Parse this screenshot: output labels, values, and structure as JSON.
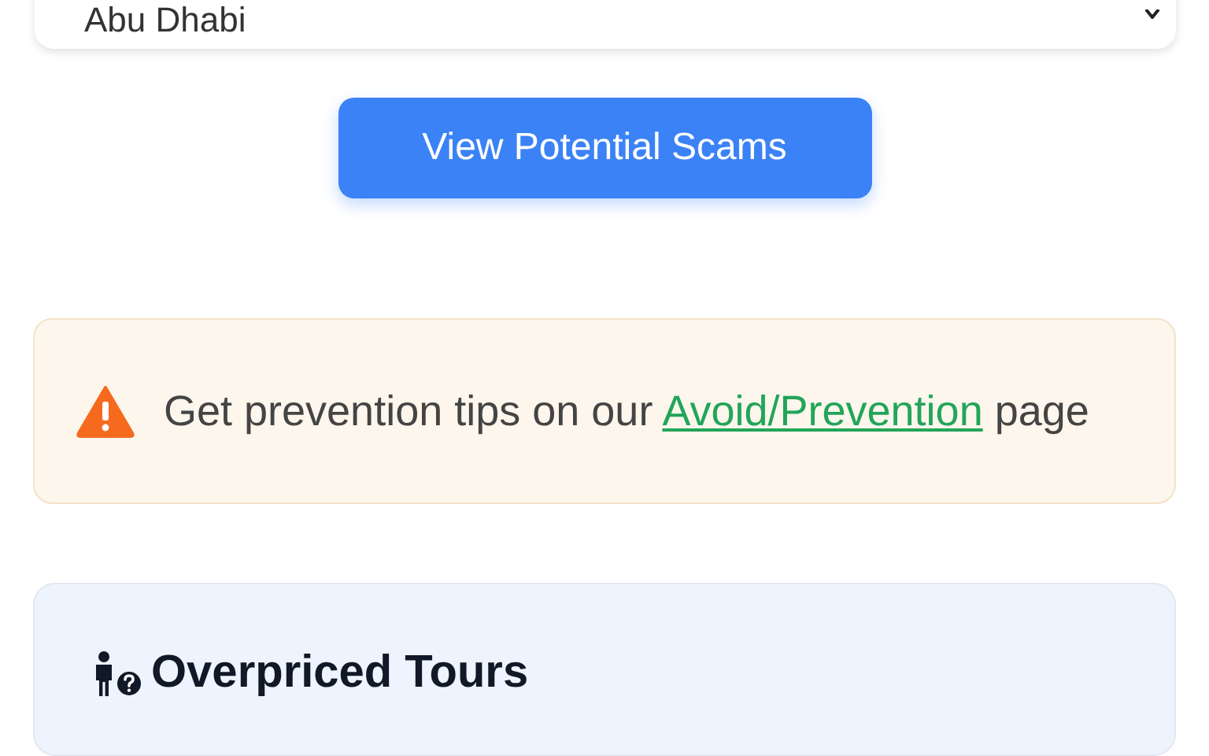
{
  "city_select": {
    "value": "Abu Dhabi"
  },
  "view_button": {
    "label": "View Potential Scams"
  },
  "alert": {
    "text_before": "Get prevention tips on our ",
    "link": "Avoid/Prevention",
    "text_after": " page"
  },
  "scam_card": {
    "title": "Overpriced Tours"
  }
}
